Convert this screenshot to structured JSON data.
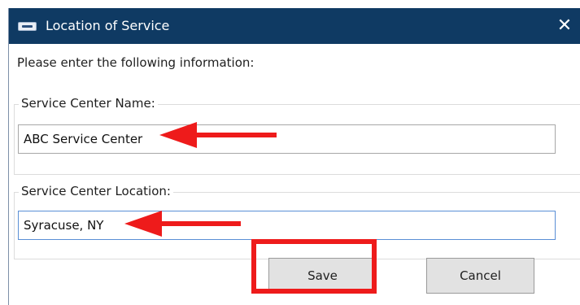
{
  "window": {
    "title": "Location of Service",
    "close_glyph": "✕",
    "app_icon": "window-app-icon"
  },
  "form": {
    "instruction": "Please enter the following information:",
    "name_group_label": "Service Center Name:",
    "name_value": "ABC Service Center",
    "location_group_label": "Service Center Location:",
    "location_value": "Syracuse, NY"
  },
  "buttons": {
    "save_label": "Save",
    "cancel_label": "Cancel"
  },
  "annotations": {
    "arrow_color": "#ee1b1b",
    "highlight_color": "#ee1b1b"
  },
  "colors": {
    "titlebar": "#0f3a63",
    "button_bg": "#e2e2e2"
  }
}
